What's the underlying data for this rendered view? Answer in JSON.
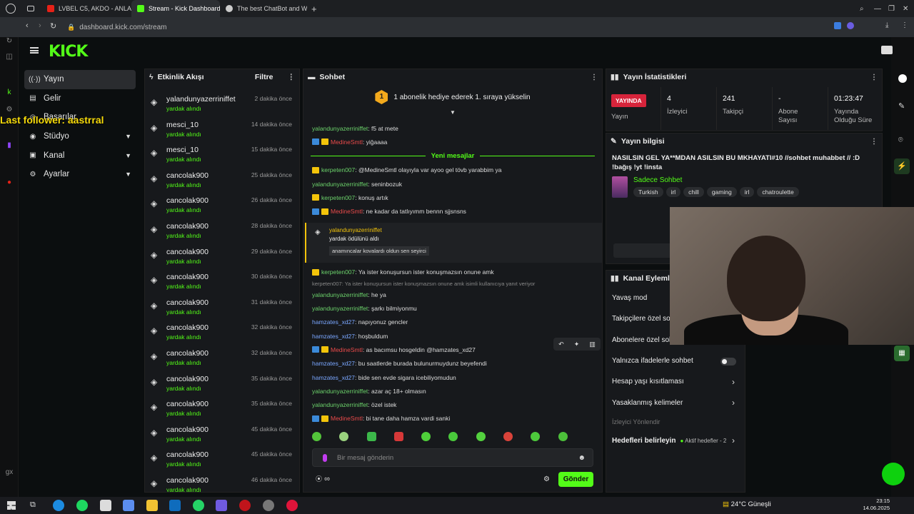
{
  "browser": {
    "tabs": [
      {
        "label": "LVBEL C5, AKDO - ANLAÇ"
      },
      {
        "label": "Stream - Kick Dashboard"
      },
      {
        "label": "The best ChatBot and W..."
      }
    ],
    "url": "dashboard.kick.com/stream"
  },
  "overlay": {
    "last_follower": "Last follower: aastrral"
  },
  "sidebar": {
    "logo": "KICK",
    "items": [
      {
        "label": "Yayın"
      },
      {
        "label": "Gelir"
      },
      {
        "label": "Başarılar"
      },
      {
        "label": "Stüdyo"
      },
      {
        "label": "Kanal"
      },
      {
        "label": "Ayarlar"
      }
    ]
  },
  "activity": {
    "title": "Etkinlik Akışı",
    "filter": "Filtre",
    "events": [
      {
        "name": "yalandunyazerriniffet",
        "action": "yardak alındı",
        "time": "2 dakika önce"
      },
      {
        "name": "mesci_10",
        "action": "yardak alındı",
        "time": "14 dakika önce"
      },
      {
        "name": "mesci_10",
        "action": "yardak alındı",
        "time": "15 dakika önce"
      },
      {
        "name": "cancolak900",
        "action": "yardak alındı",
        "time": "25 dakika önce"
      },
      {
        "name": "cancolak900",
        "action": "yardak alındı",
        "time": "26 dakika önce"
      },
      {
        "name": "cancolak900",
        "action": "yardak alındı",
        "time": "28 dakika önce"
      },
      {
        "name": "cancolak900",
        "action": "yardak alındı",
        "time": "29 dakika önce"
      },
      {
        "name": "cancolak900",
        "action": "yardak alındı",
        "time": "30 dakika önce"
      },
      {
        "name": "cancolak900",
        "action": "yardak alındı",
        "time": "31 dakika önce"
      },
      {
        "name": "cancolak900",
        "action": "yardak alındı",
        "time": "32 dakika önce"
      },
      {
        "name": "cancolak900",
        "action": "yardak alındı",
        "time": "32 dakika önce"
      },
      {
        "name": "cancolak900",
        "action": "yardak alındı",
        "time": "35 dakika önce"
      },
      {
        "name": "cancolak900",
        "action": "yardak alındı",
        "time": "35 dakika önce"
      },
      {
        "name": "cancolak900",
        "action": "yardak alındı",
        "time": "45 dakika önce"
      },
      {
        "name": "cancolak900",
        "action": "yardak alındı",
        "time": "45 dakika önce"
      },
      {
        "name": "cancolak900",
        "action": "yardak alındı",
        "time": "46 dakika önce"
      }
    ]
  },
  "chat": {
    "title": "Sohbet",
    "pinned": "1 abonelik hediye ederek 1. sıraya yükselin",
    "new_messages": "Yeni mesajlar",
    "messages_top": [
      {
        "user": "yalandunyazerriniffet",
        "text": ": f5 at mete"
      },
      {
        "user": "MedineSmtl",
        "text": ": yiğaaaa"
      }
    ],
    "messages_mid": [
      {
        "user": "kerpeten007",
        "text": ": @MedineSmtl olayıyla var ayoo gel tövb yarabbim ya"
      },
      {
        "user": "yalandunyazerriniffet",
        "text": ": seninbozuk"
      },
      {
        "user": "kerpeten007",
        "text": ": konuş artık"
      },
      {
        "user": "MedineSmtl",
        "text": ": ne kadar da tatlıyımm bennn sjjsnsns"
      }
    ],
    "redeem": {
      "user": "yalandunyazerriniffet",
      "line": "yardak ödülünü aldı",
      "msg": "anamıncalar kovalardı oldun sen seyirci"
    },
    "messages_low": [
      {
        "user": "kerpeten007",
        "text": ": Ya ister konuşursun ister konuşmazsın onune amk"
      },
      {
        "reply": "kerpeten007: Ya ister konuşursun ister konuşmazsın onune amk isimli kullanıcıya yanıt veriyor"
      },
      {
        "user": "yalandunyazerriniffet",
        "text": ": he ya"
      },
      {
        "user": "yalandunyazerriniffet",
        "text": ": şarkı bilmiyonmu"
      },
      {
        "user": "hamzates_xd27",
        "text": ": napıyonuz gencler"
      },
      {
        "user": "hamzates_xd27",
        "text": ": hoşbuldum"
      },
      {
        "user": "MedineSmtl",
        "text": ": as bacımsu hosgeldin @hamzates_xd27"
      },
      {
        "user": "hamzates_xd27",
        "text": ": bu saatlerde burada bulunurmuydunz beyefendi"
      },
      {
        "user": "hamzates_xd27",
        "text": ": bide sen evde sigara icebiliyomudun"
      },
      {
        "user": "yalandunyazerriniffet",
        "text": ": azar aç 18+ olmasın"
      },
      {
        "user": "yalandunyazerriniffet",
        "text": ": özel istek"
      },
      {
        "user": "MedineSmtl",
        "text": ": bi tane daha hamza vardi sanki"
      }
    ],
    "input_placeholder": "Bir mesaj gönderin",
    "points": "∞",
    "send": "Gönder"
  },
  "stats": {
    "title": "Yayın İstatistikleri",
    "live": "YAYINDA",
    "live_label": "Yayın",
    "viewers": "4",
    "viewers_label": "İzleyici",
    "followers": "241",
    "followers_label": "Takipçi",
    "subs": "-",
    "subs_label": "Abone Sayısı",
    "uptime": "01:23:47",
    "uptime_label": "Yayında Olduğu Süre"
  },
  "info": {
    "title": "Yayın bilgisi",
    "stream_title": "NASILSIN GEL YA**MDAN ASILSIN BU MKHAYATI#10 //sohbet muhabbet // :D !bağış !yt !insta",
    "category": "Sadece Sohbet",
    "tags": [
      "Turkish",
      "irl",
      "chill",
      "gaming",
      "irl",
      "chatroulette"
    ]
  },
  "actions": {
    "title": "Kanal Eylemleri",
    "items": [
      {
        "label": "Yavaş mod"
      },
      {
        "label": "Takipçilere özel sohbet"
      },
      {
        "label": "Abonelere özel sohbet"
      },
      {
        "label": "Yalnızca ifadelerle sohbet"
      },
      {
        "label": "Hesap yaşı kısıtlaması"
      },
      {
        "label": "Yasaklanmış kelimeler"
      }
    ],
    "redirect": "İzleyici Yönlendir",
    "goals": "Hedefleri belirleyin",
    "goals_badge": "Aktif hedefler - 2"
  },
  "taskbar": {
    "weather": "24°C  Güneşli",
    "time": "23:15",
    "date": "14.06.2025"
  },
  "colors": {
    "brand": "#53fc18",
    "live": "#d7243b"
  }
}
